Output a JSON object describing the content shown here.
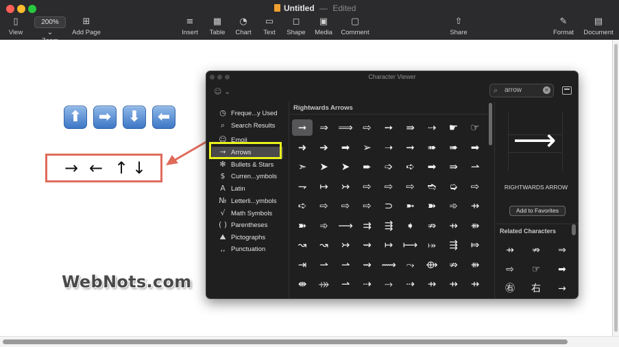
{
  "window": {
    "title": "Untitled",
    "separator": "—",
    "status": "Edited"
  },
  "toolbar": {
    "view": {
      "label": "View",
      "icon": "sidebar-icon"
    },
    "zoom": {
      "label": "Zoom",
      "value": "200%",
      "icon": "chevron-down-icon"
    },
    "add_page": {
      "label": "Add Page",
      "icon": "plus-square-icon"
    },
    "insert": {
      "label": "Insert",
      "icon": "insert-paragraph-icon"
    },
    "table": {
      "label": "Table",
      "icon": "table-icon"
    },
    "chart": {
      "label": "Chart",
      "icon": "chart-icon"
    },
    "text": {
      "label": "Text",
      "icon": "text-box-icon"
    },
    "shape": {
      "label": "Shape",
      "icon": "shape-icon"
    },
    "media": {
      "label": "Media",
      "icon": "media-icon"
    },
    "comment": {
      "label": "Comment",
      "icon": "comment-icon"
    },
    "share": {
      "label": "Share",
      "icon": "share-icon"
    },
    "format": {
      "label": "Format",
      "icon": "paintbrush-icon"
    },
    "document": {
      "label": "Document",
      "icon": "document-icon"
    }
  },
  "document": {
    "emoji_arrows": [
      "⬆",
      "➡",
      "⬇",
      "⬅"
    ],
    "text_arrows": [
      "→",
      "←",
      "↑",
      "↓"
    ],
    "logo": "WebNots.com",
    "highlight_color": "#e06a5a"
  },
  "character_viewer": {
    "title": "Character Viewer",
    "search": {
      "value": "arrow"
    },
    "sidebar": [
      {
        "label": "Freque...y Used",
        "icon": "clock-icon",
        "glyph": "◷"
      },
      {
        "label": "Search Results",
        "icon": "search-icon",
        "glyph": "⌕"
      },
      {
        "label": "Emoji",
        "icon": "emoji-icon",
        "glyph": "☺"
      },
      {
        "label": "Arrows",
        "icon": "arrow-icon",
        "glyph": "→",
        "selected": true
      },
      {
        "label": "Bullets & Stars",
        "icon": "asterisk-icon",
        "glyph": "✻"
      },
      {
        "label": "Curren...ymbols",
        "icon": "dollar-icon",
        "glyph": "$"
      },
      {
        "label": "Latin",
        "icon": "latin-icon",
        "glyph": "A"
      },
      {
        "label": "Letterli...ymbols",
        "icon": "numero-icon",
        "glyph": "№"
      },
      {
        "label": "Math Symbols",
        "icon": "sqrt-icon",
        "glyph": "√"
      },
      {
        "label": "Parentheses",
        "icon": "parentheses-icon",
        "glyph": "( )"
      },
      {
        "label": "Pictographs",
        "icon": "pictograph-icon",
        "glyph": "⛰"
      },
      {
        "label": "Punctuation",
        "icon": "punctuation-icon",
        "glyph": "‚‚"
      }
    ],
    "selection_color": "#e8f21c",
    "grid": {
      "heading": "Rightwards Arrows",
      "rows": [
        [
          "➞",
          "⇒",
          "⟹",
          "⇨",
          "➙",
          "⇛",
          "⇢",
          "☛",
          "☞"
        ],
        [
          "➜",
          "➔",
          "➡",
          "➢",
          "➝",
          "➞",
          "➠",
          "➠",
          "➡"
        ],
        [
          "➣",
          "➤",
          "➤",
          "➨",
          "➩",
          "➪",
          "➡",
          "⇛",
          "⇀"
        ],
        [
          "⇁",
          "↦",
          "↣",
          "⇨",
          "⇨",
          "⇨",
          "➬",
          "➭",
          "⇨"
        ],
        [
          "➪",
          "⇨",
          "⇨",
          "⇨",
          "⊃",
          "➼",
          "➽",
          "➾",
          "⇸"
        ],
        [
          "➽",
          "➾",
          "⟶",
          "⇉",
          "⇶",
          "➧",
          "⇏",
          "⇸",
          "⇻"
        ],
        [
          "↝",
          "↝",
          "↣",
          "⇝",
          "↦",
          "⟼",
          "⤅",
          "⇶",
          "⤇"
        ],
        [
          "⇥",
          "⇀",
          "⇀",
          "⇝",
          "⟿",
          "⤳",
          "⟴",
          "⇏",
          "⇻"
        ],
        [
          "⇼",
          "⤀",
          "⇀",
          "⇢",
          "⤑",
          "⇢",
          "⇸",
          "⇸",
          "⇸"
        ]
      ]
    },
    "preview": {
      "glyph": "⟶",
      "name": "RIGHTWARDS ARROW",
      "add_favorites": "Add to Favorites"
    },
    "related": {
      "heading": "Related Characters",
      "items": [
        "⇸",
        "⇏",
        "⇒",
        "⇨",
        "☞",
        "➡",
        "㊨",
        "右",
        "→"
      ]
    }
  }
}
